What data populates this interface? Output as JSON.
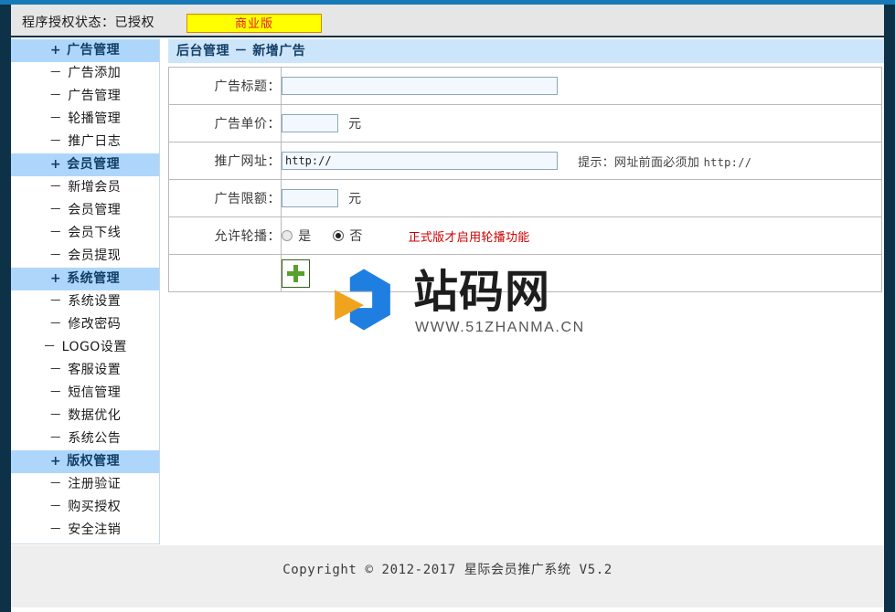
{
  "header": {
    "license_label": "程序授权状态：已授权",
    "license_badge": "商业版"
  },
  "sidebar": {
    "groups": [
      {
        "sign": "+",
        "label": "广告管理",
        "items": [
          {
            "sign": "－",
            "label": "广告添加"
          },
          {
            "sign": "－",
            "label": "广告管理"
          },
          {
            "sign": "－",
            "label": "轮播管理"
          },
          {
            "sign": "－",
            "label": "推广日志"
          }
        ]
      },
      {
        "sign": "+",
        "label": "会员管理",
        "items": [
          {
            "sign": "－",
            "label": "新增会员"
          },
          {
            "sign": "－",
            "label": "会员管理"
          },
          {
            "sign": "－",
            "label": "会员下线"
          },
          {
            "sign": "－",
            "label": "会员提现"
          }
        ]
      },
      {
        "sign": "+",
        "label": "系统管理",
        "items": [
          {
            "sign": "－",
            "label": "系统设置"
          },
          {
            "sign": "－",
            "label": "修改密码"
          },
          {
            "sign": "－",
            "label": "LOGO设置"
          },
          {
            "sign": "－",
            "label": "客服设置"
          },
          {
            "sign": "－",
            "label": "短信管理"
          },
          {
            "sign": "－",
            "label": "数据优化"
          },
          {
            "sign": "－",
            "label": "系统公告"
          }
        ]
      },
      {
        "sign": "+",
        "label": "版权管理",
        "items": [
          {
            "sign": "－",
            "label": "注册验证"
          },
          {
            "sign": "－",
            "label": "购买授权"
          },
          {
            "sign": "－",
            "label": "安全注销"
          }
        ]
      }
    ]
  },
  "main": {
    "panel_title": "后台管理 － 新增广告",
    "form": {
      "title_label": "广告标题：",
      "title_value": "",
      "title_placeholder": "",
      "price_label": "广告单价：",
      "price_value": "",
      "price_unit": "元",
      "url_label": "推广网址：",
      "url_value": "http://",
      "url_hint": "提示：网址前面必须加 ",
      "url_hint_mono": "http://",
      "quota_label": "广告限额：",
      "quota_value": "",
      "quota_unit": "元",
      "rotate_label": "允许轮播：",
      "rotate_yes": "是",
      "rotate_no": "否",
      "rotate_selected": "否",
      "rotate_warning": "正式版才启用轮播功能",
      "submit_icon": "plus-icon"
    }
  },
  "watermark": {
    "brand": "站码网",
    "url": "WWW.51ZHANMA.CN"
  },
  "footer": {
    "copyright": "Copyright © 2012-2017 星际会员推广系统 V5.2"
  },
  "colors": {
    "top_bar": "#1779b8",
    "frame": "#0d3147",
    "group_bg": "#aed6fb",
    "panel_title_bg": "#cde5fb",
    "badge_bg": "#ffff00",
    "badge_text": "#e02020",
    "warning": "#cc0000",
    "plus_green": "#57a02c"
  }
}
